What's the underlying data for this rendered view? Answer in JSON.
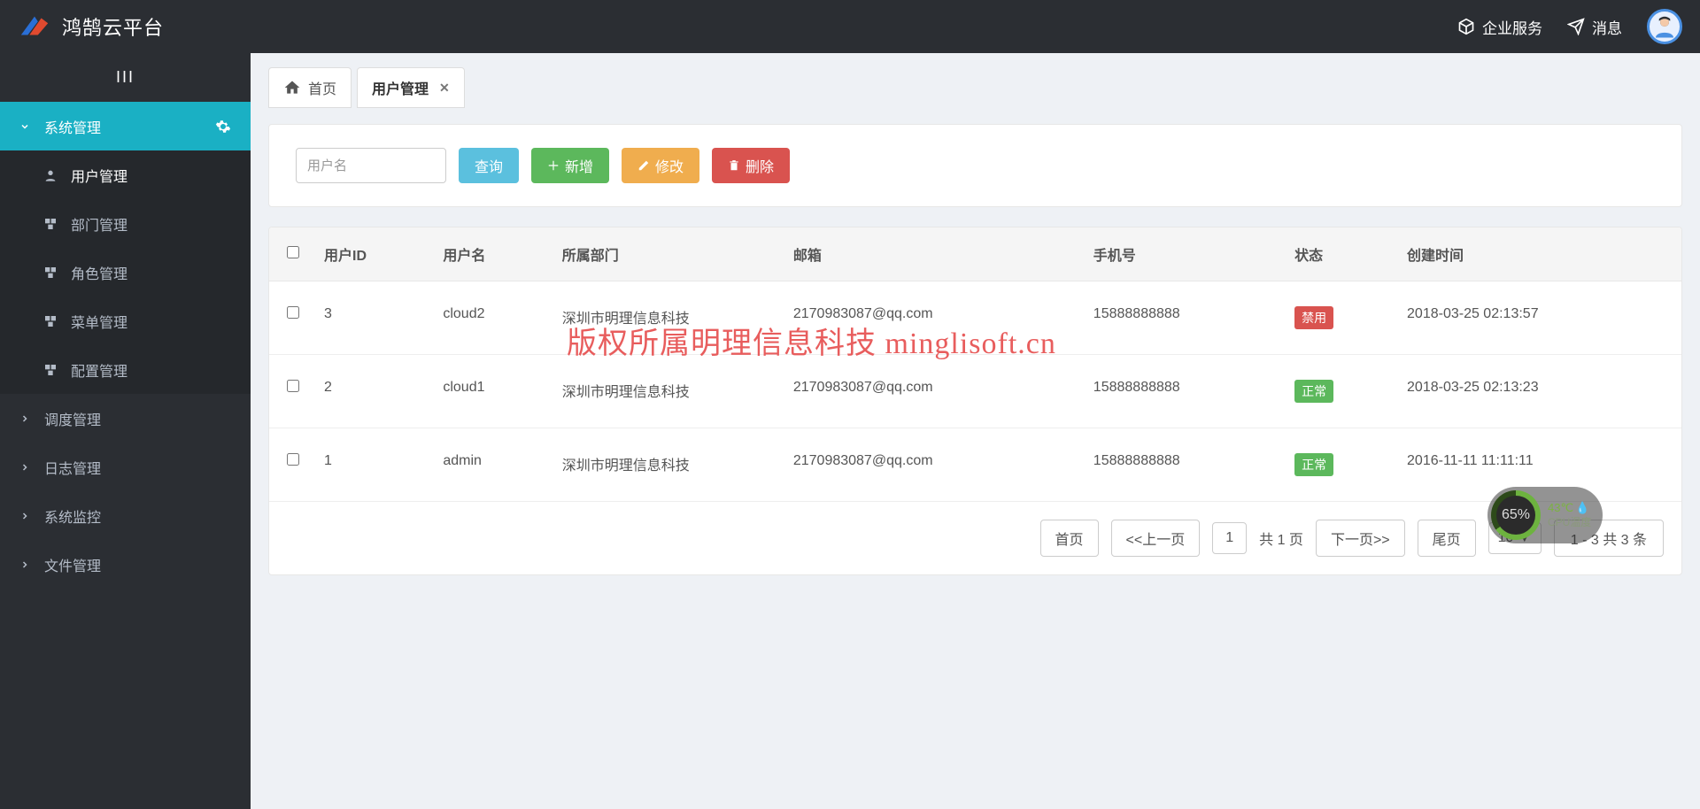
{
  "header": {
    "brand": "鸿鹄云平台",
    "links": {
      "enterprise": "企业服务",
      "messages": "消息"
    }
  },
  "sidebar": {
    "items": [
      {
        "label": "系统管理",
        "expanded": true,
        "active": true
      },
      {
        "label": "调度管理"
      },
      {
        "label": "日志管理"
      },
      {
        "label": "系统监控"
      },
      {
        "label": "文件管理"
      }
    ],
    "submenu": [
      {
        "label": "用户管理",
        "selected": true
      },
      {
        "label": "部门管理"
      },
      {
        "label": "角色管理"
      },
      {
        "label": "菜单管理"
      },
      {
        "label": "配置管理"
      }
    ]
  },
  "tabs": {
    "home": "首页",
    "user_mgmt": "用户管理"
  },
  "toolbar": {
    "username_placeholder": "用户名",
    "query": "查询",
    "add": "新增",
    "edit": "修改",
    "delete": "删除"
  },
  "table": {
    "headers": {
      "userid": "用户ID",
      "username": "用户名",
      "dept": "所属部门",
      "email": "邮箱",
      "phone": "手机号",
      "status": "状态",
      "created": "创建时间"
    },
    "status_labels": {
      "disabled": "禁用",
      "normal": "正常"
    },
    "rows": [
      {
        "userid": "3",
        "username": "cloud2",
        "dept": "深圳市明理信息科技",
        "email": "2170983087@qq.com",
        "phone": "15888888888",
        "status": "disabled",
        "created": "2018-03-25 02:13:57"
      },
      {
        "userid": "2",
        "username": "cloud1",
        "dept": "深圳市明理信息科技",
        "email": "2170983087@qq.com",
        "phone": "15888888888",
        "status": "normal",
        "created": "2018-03-25 02:13:23"
      },
      {
        "userid": "1",
        "username": "admin",
        "dept": "深圳市明理信息科技",
        "email": "2170983087@qq.com",
        "phone": "15888888888",
        "status": "normal",
        "created": "2016-11-11 11:11:11"
      }
    ]
  },
  "pagination": {
    "first": "首页",
    "prev": "<<上一页",
    "page": "1",
    "total_pages": "共 1 页",
    "next": "下一页>>",
    "last": "尾页",
    "page_size": "10 ▼",
    "summary": "1 - 3   共 3 条"
  },
  "watermark": "版权所属明理信息科技 minglisoft.cn",
  "cpu_widget": {
    "percent": "65%",
    "temp": "43℃",
    "label": "CPU温度"
  }
}
